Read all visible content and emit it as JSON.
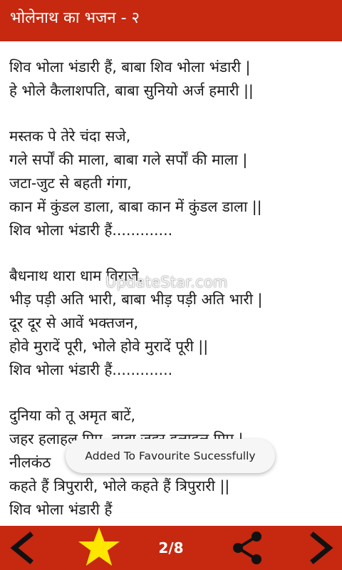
{
  "appbar": {
    "title": "भोलेनाथ का भजन - २"
  },
  "lyrics": {
    "stanzas": [
      [
        "शिव भोला भंडारी हैं, बाबा शिव भोला भंडारी |",
        "हे भोले कैलाशपति, बाबा सुनियो अर्ज हमारी ||"
      ],
      [
        "मस्तक पे तेरे चंदा सजे,",
        "गले सर्पों की माला, बाबा गले सर्पों की माला |",
        "जटा-जुट से बहती गंगा,",
        "कान में कुंडल डाला, बाबा कान में कुंडल डाला ||",
        "शिव भोला भंडारी हैं............."
      ],
      [
        "बैधनाथ थारा धाम विराजे,",
        "भीड़ पड़ी अति भारी, बाबा भीड़ पड़ी अति भारी |",
        "दूर दूर से आवें भक्तजन,",
        "होवे मुरादें पूरी, भोले होवे मुरादें पूरी ||",
        "शिव भोला भंडारी हैं............."
      ],
      [
        "दुनिया को तू अमृत बाटें,",
        "जहर हलाहल पिए, बाबा जहर हलाहल पिए |",
        "नीलकंठ",
        "कहते हैं त्रिपुरारी, भोले कहते हैं त्रिपुरारी ||",
        "शिव भोला भंडारी हैं"
      ]
    ]
  },
  "watermark": "UpdateStar.com",
  "toast": {
    "message": "Added To Favourite Sucessfully"
  },
  "bottombar": {
    "page_indicator": "2/8",
    "icons": {
      "prev": "chevron-left-icon",
      "favourite": "star-icon",
      "share": "share-icon",
      "next": "chevron-right-icon"
    }
  },
  "colors": {
    "primary": "#c62810",
    "star": "#ffe600",
    "text": "#1a1a1a"
  }
}
